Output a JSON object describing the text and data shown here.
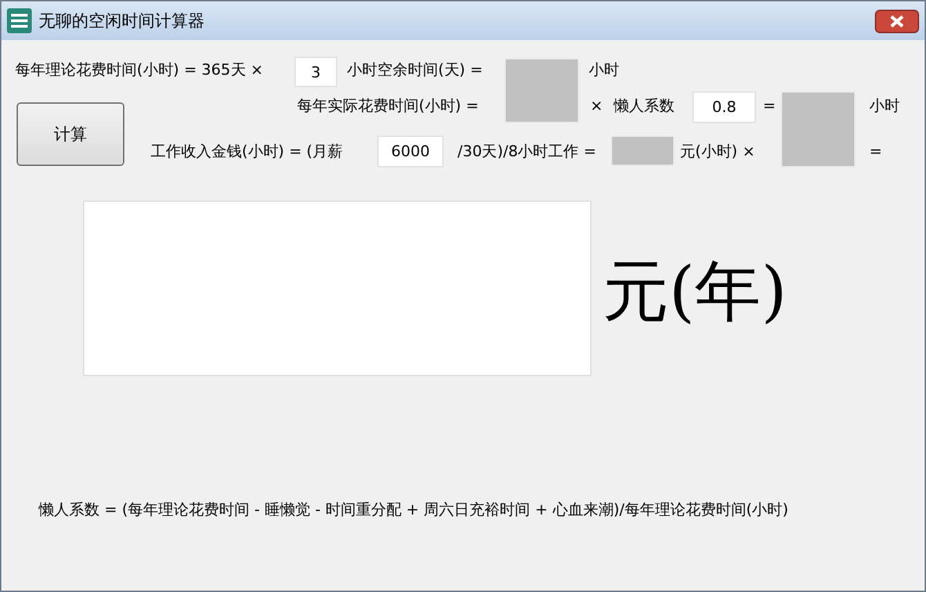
{
  "window": {
    "title": "无聊的空闲时间计算器"
  },
  "row_1": {
    "label": "每年理论花费时间(小时) = 365天 ×",
    "hours_input": "3",
    "label_2": "小时空余时间(天) =",
    "unit": "小时"
  },
  "row_2": {
    "label": "每年实际花费时间(小时) =",
    "times": "×",
    "factor_label": "懒人系数",
    "factor_input": "0.8",
    "equals": "=",
    "unit": "小时"
  },
  "row_3": {
    "label": "工作收入金钱(小时) = (月薪",
    "salary_input": "6000",
    "label_2": "/30天)/8小时工作 =",
    "label_3": "元(小时) ×",
    "equals": "="
  },
  "calculate_button": "计算",
  "result_unit": "元(年)",
  "formula_note": "懒人系数 = (每年理论花费时间 - 睡懒觉 - 时间重分配 + 周六日充裕时间 + 心血来潮)/每年理论花费时间(小时)"
}
